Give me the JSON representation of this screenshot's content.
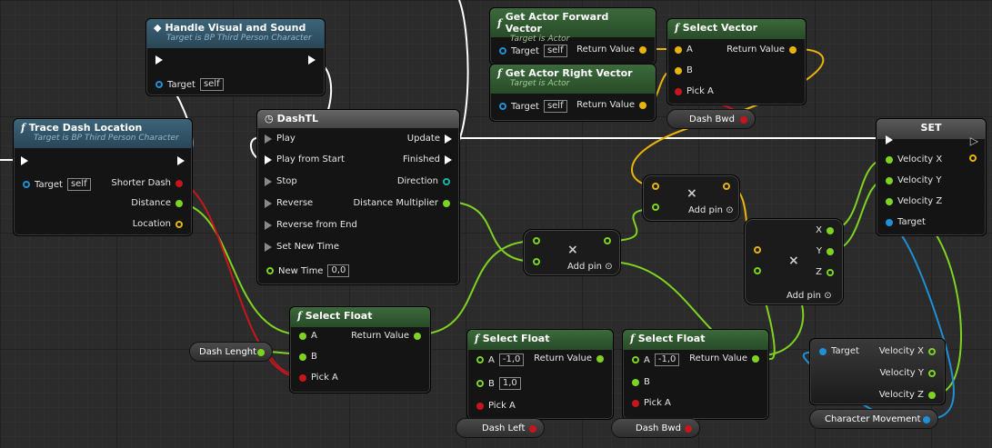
{
  "nodes": {
    "handle": {
      "title": "Handle Visual and Sound",
      "subtitle": "Target is BP Third Person Character",
      "target_label": "Target",
      "target_value": "self"
    },
    "trace": {
      "title": "Trace Dash Location",
      "subtitle": "Target is BP Third Person Character",
      "target_label": "Target",
      "target_value": "self",
      "shorter_dash": "Shorter Dash",
      "distance": "Distance",
      "location": "Location"
    },
    "dashtl": {
      "title": "DashTL",
      "play": "Play",
      "play_from_start": "Play from Start",
      "stop": "Stop",
      "reverse": "Reverse",
      "reverse_from_end": "Reverse from End",
      "set_new_time": "Set New Time",
      "new_time": "New Time",
      "new_time_value": "0,0",
      "update": "Update",
      "finished": "Finished",
      "direction": "Direction",
      "distance_multiplier": "Distance Multiplier"
    },
    "forward": {
      "title": "Get Actor Forward Vector",
      "subtitle": "Target is Actor",
      "target_label": "Target",
      "target_value": "self",
      "return": "Return Value"
    },
    "right": {
      "title": "Get Actor Right Vector",
      "subtitle": "Target is Actor",
      "target_label": "Target",
      "target_value": "self",
      "return": "Return Value"
    },
    "select_vector": {
      "title": "Select Vector",
      "a": "A",
      "b": "B",
      "pick": "Pick A",
      "return": "Return Value"
    },
    "set": {
      "title": "SET",
      "vx": "Velocity X",
      "vy": "Velocity Y",
      "vz": "Velocity Z",
      "target": "Target"
    },
    "mult1": {
      "add_pin": "Add pin"
    },
    "mult2": {
      "add_pin": "Add pin"
    },
    "break_vec": {
      "x": "X",
      "y": "Y",
      "z": "Z",
      "add_pin": "Add pin"
    },
    "select_float_1": {
      "title": "Select Float",
      "a": "A",
      "b": "B",
      "pick": "Pick A",
      "return": "Return Value"
    },
    "select_float_2": {
      "title": "Select Float",
      "a": "A",
      "a_value": "-1,0",
      "b": "B",
      "b_value": "1,0",
      "pick": "Pick A",
      "return": "Return Value"
    },
    "select_float_3": {
      "title": "Select Float",
      "a": "A",
      "a_value": "-1,0",
      "b": "B",
      "pick": "Pick A",
      "return": "Return Value"
    },
    "velocity": {
      "target": "Target",
      "vx": "Velocity X",
      "vy": "Velocity Y",
      "vz": "Velocity Z"
    }
  },
  "variables": {
    "dash_bwd_top": "Dash Bwd",
    "dash_lenght": "Dash Lenght",
    "dash_left": "Dash Left",
    "dash_bwd_bottom": "Dash Bwd",
    "character_movement": "Character Movement"
  },
  "colors": {
    "exec": "#ffffff",
    "float": "#7ed321",
    "bool": "#c8151c",
    "vector": "#e8b40c",
    "object": "#1f8fd6"
  }
}
